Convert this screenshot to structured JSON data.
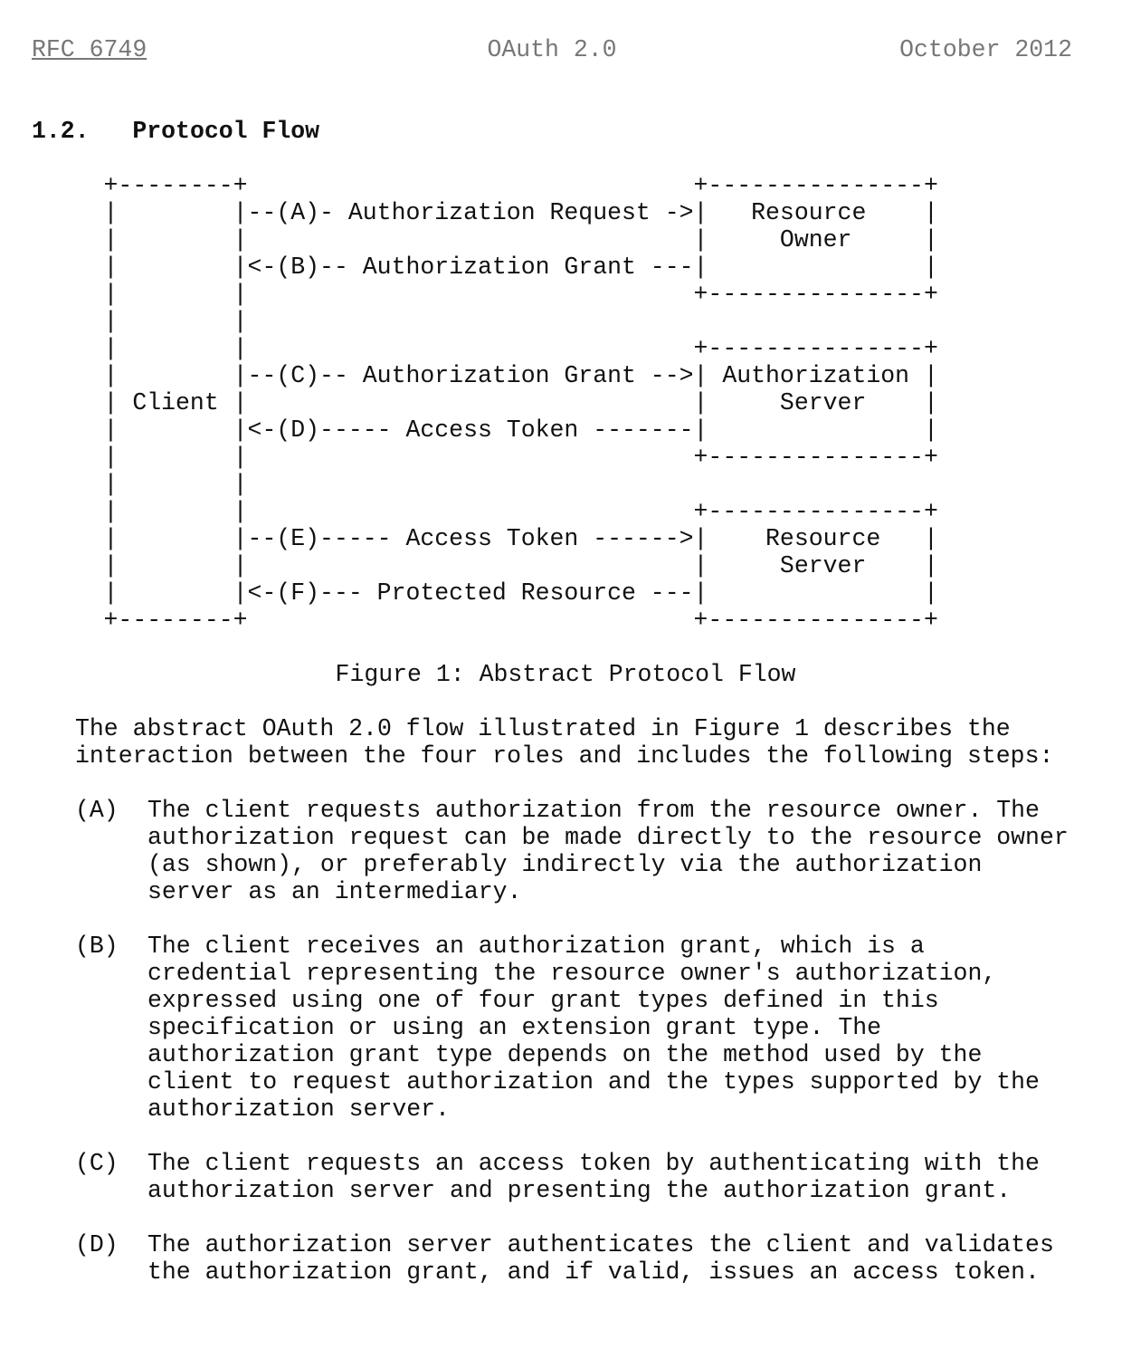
{
  "header": {
    "left": "RFC 6749",
    "center": "OAuth 2.0",
    "right": "October 2012"
  },
  "section": {
    "number": "1.2.",
    "title": "Protocol Flow"
  },
  "figure": {
    "ascii": "     +--------+                               +---------------+\n     |        |--(A)- Authorization Request ->|   Resource    |\n     |        |                               |     Owner     |\n     |        |<-(B)-- Authorization Grant ---|               |\n     |        |                               +---------------+\n     |        |\n     |        |                               +---------------+\n     |        |--(C)-- Authorization Grant -->| Authorization |\n     | Client |                               |     Server    |\n     |        |<-(D)----- Access Token -------|               |\n     |        |                               +---------------+\n     |        |\n     |        |                               +---------------+\n     |        |--(E)----- Access Token ------>|    Resource   |\n     |        |                               |     Server    |\n     |        |<-(F)--- Protected Resource ---|               |\n     +--------+                               +---------------+",
    "caption": "Figure 1: Abstract Protocol Flow"
  },
  "intro": "The abstract OAuth 2.0 flow illustrated in Figure 1 describes the\ninteraction between the four roles and includes the following steps:",
  "steps": [
    {
      "marker": "(A)",
      "text": "The client requests authorization from the resource owner.  The\nauthorization request can be made directly to the resource owner\n(as shown), or preferably indirectly via the authorization\nserver as an intermediary."
    },
    {
      "marker": "(B)",
      "text": "The client receives an authorization grant, which is a\ncredential representing the resource owner's authorization,\nexpressed using one of four grant types defined in this\nspecification or using an extension grant type.  The\nauthorization grant type depends on the method used by the\nclient to request authorization and the types supported by the\nauthorization server."
    },
    {
      "marker": "(C)",
      "text": "The client requests an access token by authenticating with the\nauthorization server and presenting the authorization grant."
    },
    {
      "marker": "(D)",
      "text": "The authorization server authenticates the client and validates\nthe authorization grant, and if valid, issues an access token."
    }
  ]
}
